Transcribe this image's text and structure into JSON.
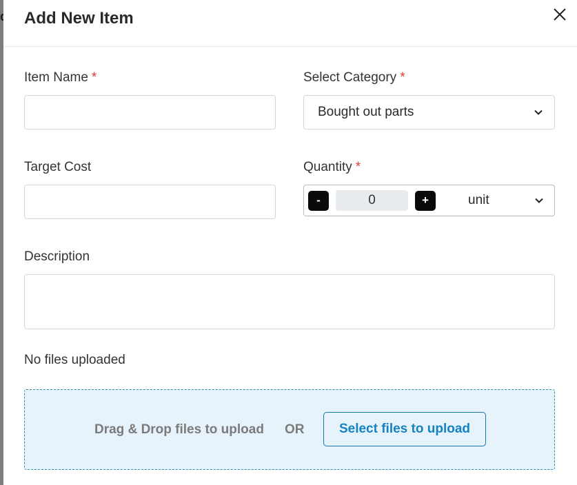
{
  "modal": {
    "title": "Add New Item",
    "close_icon": "close-icon"
  },
  "form": {
    "item_name": {
      "label": "Item Name",
      "required_mark": "*",
      "value": ""
    },
    "category": {
      "label": "Select Category",
      "required_mark": "*",
      "selected": "Bought out parts"
    },
    "target_cost": {
      "label": "Target Cost",
      "value": ""
    },
    "quantity": {
      "label": "Quantity",
      "required_mark": "*",
      "decrement_label": "-",
      "increment_label": "+",
      "value": "0",
      "unit": "unit"
    },
    "description": {
      "label": "Description",
      "value": ""
    }
  },
  "files": {
    "status": "No files uploaded",
    "drop_text": "Drag & Drop files to upload",
    "or_text": "OR",
    "select_button": "Select files to upload"
  },
  "colors": {
    "required": "#e53935",
    "dropzone_bg": "#e6f3fb",
    "dropzone_border": "#2a8fa8",
    "link_blue": "#1583c2"
  }
}
